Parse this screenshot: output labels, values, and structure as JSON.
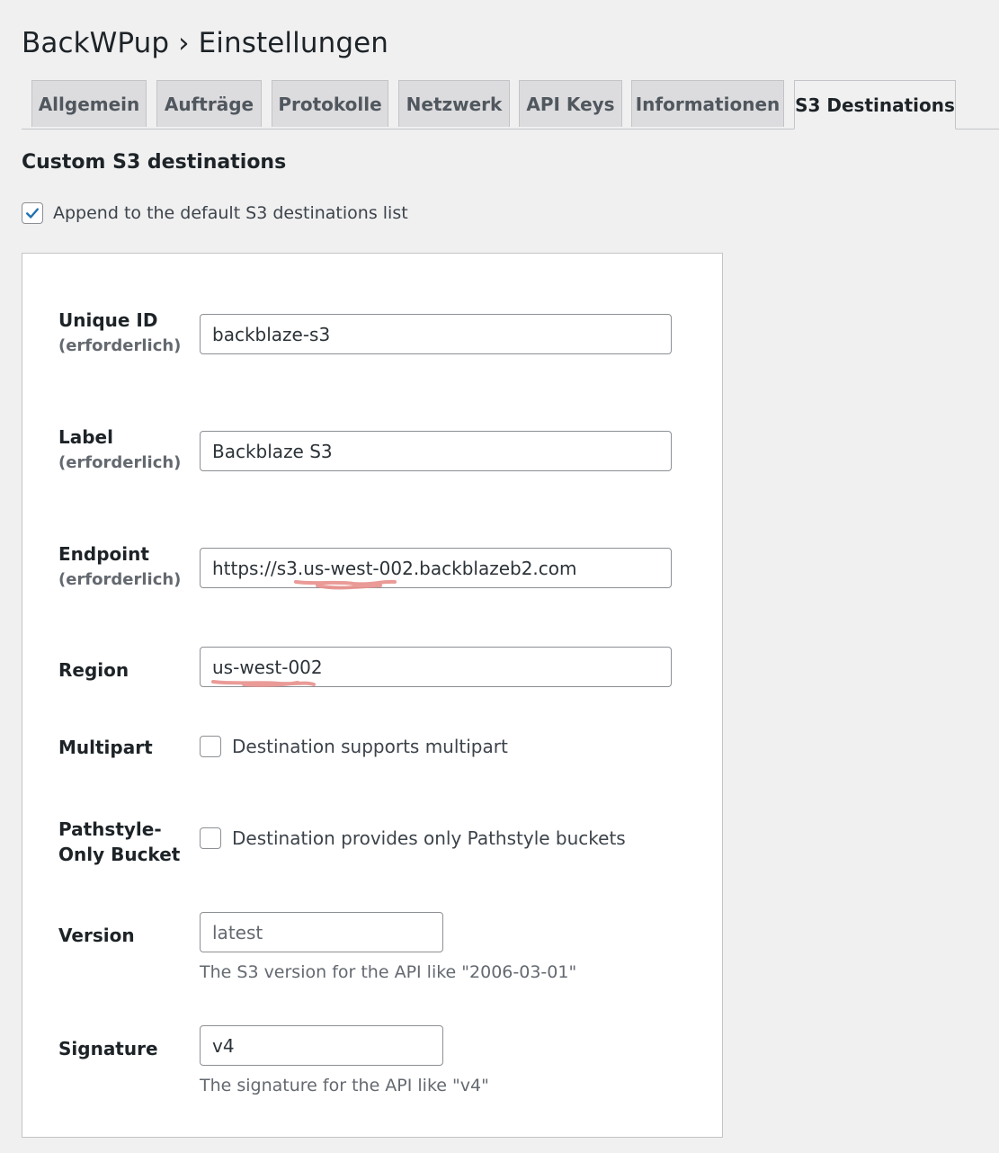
{
  "page": {
    "title": "BackWPup › Einstellungen"
  },
  "tabs": [
    {
      "label": "Allgemein"
    },
    {
      "label": "Aufträge"
    },
    {
      "label": "Protokolle"
    },
    {
      "label": "Netzwerk"
    },
    {
      "label": "API Keys"
    },
    {
      "label": "Informationen"
    },
    {
      "label": "S3 Destinations",
      "active": true
    }
  ],
  "section": {
    "title": "Custom S3 destinations",
    "append_label": "Append to the default S3 destinations list",
    "append_checked": true
  },
  "form": {
    "required_text": "(erforderlich)",
    "unique_id": {
      "label": "Unique ID",
      "value": "backblaze-s3"
    },
    "label": {
      "label": "Label",
      "value": "Backblaze S3"
    },
    "endpoint": {
      "label": "Endpoint",
      "value": "https://s3.us-west-002.backblazeb2.com"
    },
    "region": {
      "label": "Region",
      "value": "us-west-002"
    },
    "multipart": {
      "label": "Multipart",
      "option": "Destination supports multipart",
      "checked": false
    },
    "pathstyle": {
      "label_line1": "Pathstyle-",
      "label_line2": "Only Bucket",
      "option": "Destination provides only Pathstyle buckets",
      "checked": false
    },
    "version": {
      "label": "Version",
      "placeholder": "latest",
      "description": "The S3 version for the API like \"2006-03-01\""
    },
    "signature": {
      "label": "Signature",
      "value": "v4",
      "description": "The signature for the API like \"v4\""
    }
  },
  "colors": {
    "accent": "#2271b1",
    "annotation": "#e8908c"
  }
}
